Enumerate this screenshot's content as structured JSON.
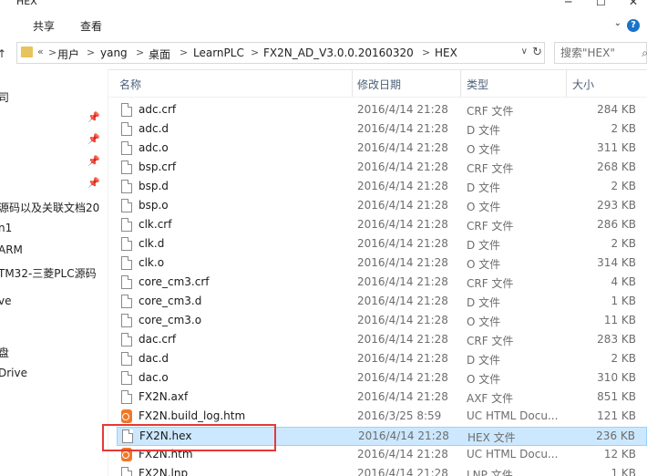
{
  "window": {
    "title": "HEX",
    "minimize_icon": "minimize-icon",
    "maximize_icon": "maximize-icon",
    "close_icon": "close-icon"
  },
  "ribbon": {
    "tabs": [
      "共享",
      "查看"
    ],
    "help_label": "?",
    "collapse_icon": "chevron-down-icon"
  },
  "address": {
    "overflow": "«",
    "crumbs": [
      "用户",
      "yang",
      "桌面",
      "LearnPLC",
      "FX2N_AD_V3.0.0.20160320",
      "HEX"
    ],
    "separator": ">"
  },
  "search": {
    "placeholder": "搜索\"HEX\"",
    "icon": "search-icon"
  },
  "nav": {
    "items": [
      "司",
      "",
      "",
      "",
      "",
      "源码以及关联文档20",
      "n1",
      "ARM",
      "TM32-三菱PLC源码",
      "ve",
      "",
      "盘",
      "Drive"
    ]
  },
  "columns": {
    "name": "名称",
    "date": "修改日期",
    "type": "类型",
    "size": "大小"
  },
  "files": [
    {
      "name": "adc.crf",
      "date": "2016/4/14 21:28",
      "type": "CRF 文件",
      "size": "284 KB",
      "icon": "file"
    },
    {
      "name": "adc.d",
      "date": "2016/4/14 21:28",
      "type": "D 文件",
      "size": "2 KB",
      "icon": "file"
    },
    {
      "name": "adc.o",
      "date": "2016/4/14 21:28",
      "type": "O 文件",
      "size": "311 KB",
      "icon": "file"
    },
    {
      "name": "bsp.crf",
      "date": "2016/4/14 21:28",
      "type": "CRF 文件",
      "size": "268 KB",
      "icon": "file"
    },
    {
      "name": "bsp.d",
      "date": "2016/4/14 21:28",
      "type": "D 文件",
      "size": "2 KB",
      "icon": "file"
    },
    {
      "name": "bsp.o",
      "date": "2016/4/14 21:28",
      "type": "O 文件",
      "size": "293 KB",
      "icon": "file"
    },
    {
      "name": "clk.crf",
      "date": "2016/4/14 21:28",
      "type": "CRF 文件",
      "size": "286 KB",
      "icon": "file"
    },
    {
      "name": "clk.d",
      "date": "2016/4/14 21:28",
      "type": "D 文件",
      "size": "2 KB",
      "icon": "file"
    },
    {
      "name": "clk.o",
      "date": "2016/4/14 21:28",
      "type": "O 文件",
      "size": "314 KB",
      "icon": "file"
    },
    {
      "name": "core_cm3.crf",
      "date": "2016/4/14 21:28",
      "type": "CRF 文件",
      "size": "4 KB",
      "icon": "file"
    },
    {
      "name": "core_cm3.d",
      "date": "2016/4/14 21:28",
      "type": "D 文件",
      "size": "1 KB",
      "icon": "file"
    },
    {
      "name": "core_cm3.o",
      "date": "2016/4/14 21:28",
      "type": "O 文件",
      "size": "11 KB",
      "icon": "file"
    },
    {
      "name": "dac.crf",
      "date": "2016/4/14 21:28",
      "type": "CRF 文件",
      "size": "283 KB",
      "icon": "file"
    },
    {
      "name": "dac.d",
      "date": "2016/4/14 21:28",
      "type": "D 文件",
      "size": "2 KB",
      "icon": "file"
    },
    {
      "name": "dac.o",
      "date": "2016/4/14 21:28",
      "type": "O 文件",
      "size": "310 KB",
      "icon": "file"
    },
    {
      "name": "FX2N.axf",
      "date": "2016/4/14 21:28",
      "type": "AXF 文件",
      "size": "851 KB",
      "icon": "file"
    },
    {
      "name": "FX2N.build_log.htm",
      "date": "2016/3/25 8:59",
      "type": "UC HTML Docu...",
      "size": "121 KB",
      "icon": "app"
    },
    {
      "name": "FX2N.hex",
      "date": "2016/4/14 21:28",
      "type": "HEX 文件",
      "size": "236 KB",
      "icon": "file",
      "selected": true
    },
    {
      "name": "FX2N.htm",
      "date": "2016/4/14 21:28",
      "type": "UC HTML Docu...",
      "size": "12 KB",
      "icon": "app"
    },
    {
      "name": "FX2N.lnp",
      "date": "2016/4/14 21:28",
      "type": "LNP 文件",
      "size": "1 KB",
      "icon": "file"
    }
  ]
}
